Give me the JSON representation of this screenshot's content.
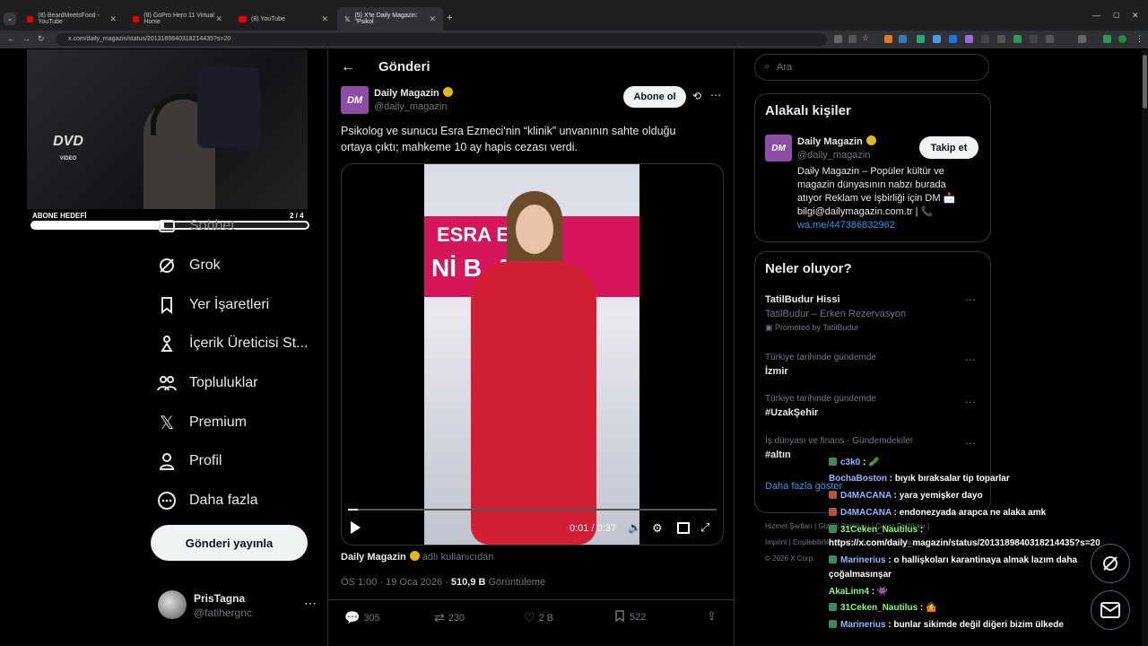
{
  "browser": {
    "tabs": [
      {
        "label": "(8) BeardMeetsFood - YouTube"
      },
      {
        "label": "(8) GoPro Hero 11 Virtual Horse"
      },
      {
        "label": "(8) YouTube"
      },
      {
        "label": "(5) X'te Daily Magazin: \"Psikol"
      }
    ],
    "url": "x.com/daily_magazin/status/2013189840318214435?s=20"
  },
  "stream": {
    "dvd_logo": "DVD",
    "dvd_sub": "VIDEO",
    "goal_label": "ABONE HEDEFİ",
    "goal_count": "2 / 4",
    "goal_progress": 0.48
  },
  "sidebar": {
    "items": [
      {
        "label": "Sohbet",
        "icon": "chat-icon"
      },
      {
        "label": "Grok",
        "icon": "grok-icon"
      },
      {
        "label": "Yer İşaretleri",
        "icon": "bookmark-icon"
      },
      {
        "label": "İçerik Üreticisi St...",
        "icon": "creator-studio-icon"
      },
      {
        "label": "Topluluklar",
        "icon": "communities-icon"
      },
      {
        "label": "Premium",
        "icon": "x-logo-icon"
      },
      {
        "label": "Profil",
        "icon": "profile-icon"
      },
      {
        "label": "Daha fazla",
        "icon": "more-circle-icon"
      }
    ],
    "post_button": "Gönderi yayınla",
    "account": {
      "name": "PrisTagna",
      "handle": "@fatihergnc"
    }
  },
  "post": {
    "header": "Gönderi",
    "author_name": "Daily Magazin",
    "author_handle": "@daily_magazin",
    "avatar_text": "DM",
    "subscribe_label": "Abone ol",
    "text": "Psikolog ve sunucu Esra Ezmeci'nin “klinik” unvanının sahte olduğu ortaya çıktı; mahkeme 10 ay hapis cezası verdi.",
    "video": {
      "banner_1": "ESRA EZ",
      "banner_2": "Nİ B  AN",
      "time": "0:01 / 0:37",
      "progress": 0.027
    },
    "source_name": "Daily Magazin",
    "source_suffix": "adlı kullanıcıdan",
    "meta_time": "ÖS 1:00 · 19 Oca 2026 · ",
    "views_count": "510,9 B",
    "views_label": "Görüntüleme",
    "stats": {
      "replies": "305",
      "reposts": "230",
      "likes": "2 B",
      "bookmarks": "522"
    }
  },
  "right": {
    "search_placeholder": "Ara",
    "related": {
      "title": "Alakalı kişiler",
      "name": "Daily Magazin",
      "handle": "@daily_magazin",
      "follow_label": "Takip et",
      "bio": "Daily Magazin – Popüler kültür ve magazin dünyasının nabzı burada atıyor Reklam ve İşbirliği için DM 📩 bilgi@dailymagazin.com.tr | 📞",
      "link": "wa.me/447386832962"
    },
    "trends": {
      "title": "Neler oluyor?",
      "items": [
        {
          "context": "",
          "title": "TatilBudur Hissi",
          "subtitle": "TatilBudur – Erken Rezervasyon",
          "promo": "Promoted by TatilBudur"
        },
        {
          "context": "Türkiye tarihinde gündemde",
          "title": "İzmir"
        },
        {
          "context": "Türkiye tarihinde gündemde",
          "title": "#UzakŞehir"
        },
        {
          "context": "İş dünyası ve finans · Gündemdekiler",
          "title": "#altın"
        }
      ],
      "show_more": "Daha fazla göster"
    },
    "footer": {
      "terms": "Hizmet Şartları",
      "privacy": "Gizlilik Politikası",
      "cookie": "Çerez Politikası",
      "imprint": "Imprint",
      "access": "Erişilebilirlik",
      "ads": "Reklam bilgisi",
      "more": "Daha fazla",
      "copyright": "© 2026 X Corp."
    }
  },
  "chat": [
    {
      "user": "c3k0",
      "message": "🥒",
      "badge": "#3c8a5c"
    },
    {
      "user": "BochaBoston",
      "message": "bıyık bıraksalar tip toparlar",
      "badge": ""
    },
    {
      "user": "D4MACANA",
      "message": "yara yemişker dayo",
      "badge": "#b5533c"
    },
    {
      "user": "D4MACANA",
      "message": "endonezyada arapca ne alaka amk",
      "badge": "#b5533c"
    },
    {
      "user": "31Ceken_Nautilus",
      "message": "",
      "badge": "#3c8a5c"
    },
    {
      "user": "",
      "message": "https://x.com/daily_magazin/status/2013189840318214435?s=20",
      "badge": ""
    },
    {
      "user": "Marinerius",
      "message": "o hallişkoları karantinaya almak lazım daha",
      "badge": "#3c8a5c"
    },
    {
      "user": "",
      "message": "çoğalmasınşar",
      "badge": ""
    },
    {
      "user": "AkaLinn4",
      "message": "👾",
      "badge": ""
    },
    {
      "user": "31Ceken_Nautilus",
      "message": "🤷",
      "badge": "#3c8a5c"
    },
    {
      "user": "Marinerius",
      "message": "bunlar sikimde değil diğeri bizim ülkede",
      "badge": "#3c8a5c"
    }
  ]
}
